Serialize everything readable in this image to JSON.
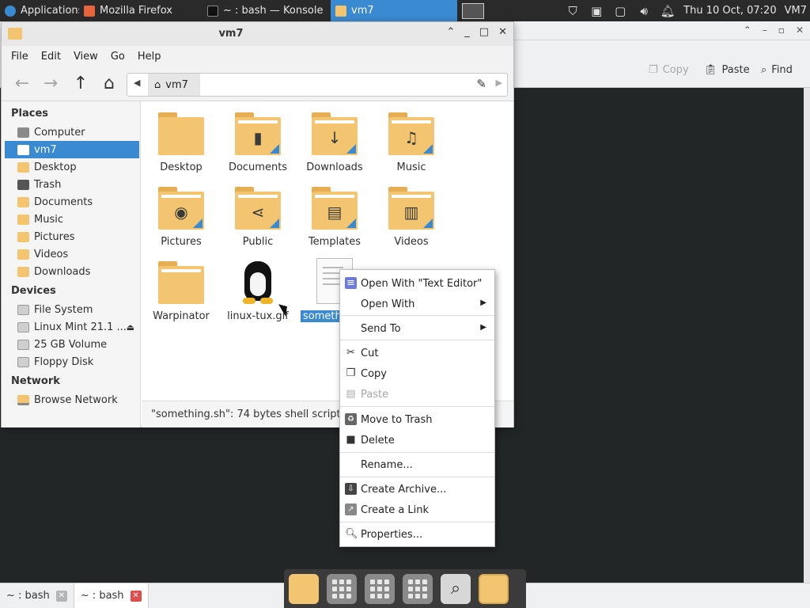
{
  "top_panel": {
    "applications_label": "Applications",
    "tasks": [
      {
        "label": "Mozilla Firefox",
        "icon": "firefox-icon"
      },
      {
        "label": "~ : bash — Konsole",
        "icon": "terminal-icon"
      },
      {
        "label": "vm7",
        "icon": "folder-icon",
        "active": true
      }
    ],
    "clock": "Thu 10 Oct, 07:20",
    "user": "VM7"
  },
  "konsole": {
    "copy_label": "Copy",
    "paste_label": "Paste",
    "find_label": "Find",
    "tabs": [
      {
        "label": "~ : bash"
      },
      {
        "label": "~ : bash",
        "active": true
      }
    ]
  },
  "thunar": {
    "title": "vm7",
    "menu": [
      "File",
      "Edit",
      "View",
      "Go",
      "Help"
    ],
    "path_current": "vm7",
    "sidebar": {
      "places_header": "Places",
      "places": [
        "Computer",
        "vm7",
        "Desktop",
        "Trash",
        "Documents",
        "Music",
        "Pictures",
        "Videos",
        "Downloads"
      ],
      "devices_header": "Devices",
      "devices": [
        "File System",
        "Linux Mint 21.1 ...",
        "25 GB Volume",
        "Floppy Disk"
      ],
      "network_header": "Network",
      "network": [
        "Browse Network"
      ]
    },
    "files": [
      "Desktop",
      "Documents",
      "Downloads",
      "Music",
      "Pictures",
      "Public",
      "Templates",
      "Videos",
      "Warpinator",
      "linux-tux.gif",
      "somethi"
    ],
    "status": "\"something.sh\": 74 bytes shell script"
  },
  "context_menu": {
    "items": [
      "Open With \"Text Editor\"",
      "Open With",
      "Send To",
      "Cut",
      "Copy",
      "Paste",
      "Move to Trash",
      "Delete",
      "Rename...",
      "Create Archive...",
      "Create a Link",
      "Properties..."
    ]
  },
  "colors": {
    "accent": "#3a8ad1",
    "folder": "#f3c571",
    "panel": "#2a2a2a"
  }
}
